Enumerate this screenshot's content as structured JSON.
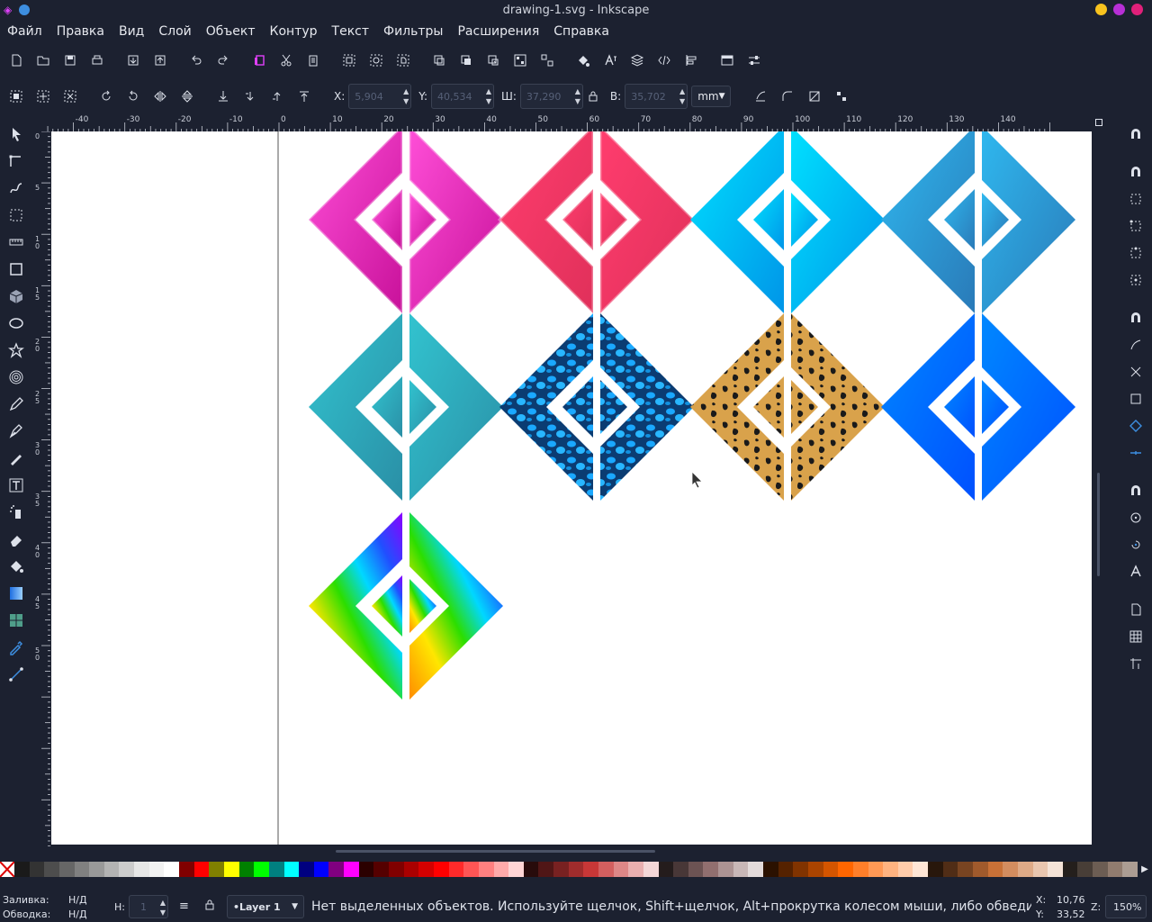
{
  "window": {
    "title": "drawing-1.svg - Inkscape"
  },
  "menu": [
    "Файл",
    "Правка",
    "Вид",
    "Слой",
    "Объект",
    "Контур",
    "Текст",
    "Фильтры",
    "Расширения",
    "Справка"
  ],
  "toolbar1": [
    "new-document-icon",
    "open-icon",
    "save-icon",
    "print-icon",
    "import-icon",
    "export-icon",
    "undo-icon",
    "redo-icon",
    "copy-icon",
    "cut-icon",
    "paste-icon",
    "zoom-selection-icon",
    "zoom-drawing-icon",
    "zoom-page-icon",
    "duplicate-icon",
    "clone-icon",
    "unlink-clone-icon",
    "group-icon",
    "ungroup-icon",
    "fill-stroke-icon",
    "text-font-icon",
    "layers-icon",
    "xml-editor-icon",
    "align-icon",
    "document-properties-icon",
    "preferences-icon"
  ],
  "toolbar2": {
    "x_label": "X:",
    "x_value": "5,904",
    "y_label": "Y:",
    "y_value": "40,534",
    "w_label": "Ш:",
    "w_value": "37,290",
    "h_label": "В:",
    "h_value": "35,702",
    "unit": "mm"
  },
  "ruler_h_labels": [
    "-40",
    "-30",
    "-20",
    "-10",
    "0",
    "10",
    "20",
    "30",
    "40",
    "50",
    "60",
    "70",
    "80",
    "90",
    "100",
    "110",
    "120",
    "130",
    "140"
  ],
  "ruler_v_labels": [
    "0",
    "5",
    "10",
    "15",
    "20",
    "25",
    "30",
    "35",
    "40",
    "45",
    "50"
  ],
  "colors": {
    "bg": "#1c2130",
    "canvas": "#ffffff",
    "accent": "#e040fb"
  },
  "palette": [
    "#1a1a1a",
    "#333333",
    "#4d4d4d",
    "#666666",
    "#808080",
    "#999999",
    "#b3b3b3",
    "#cccccc",
    "#e6e6e6",
    "#f2f2f2",
    "#ffffff",
    "#800000",
    "#ff0000",
    "#808000",
    "#ffff00",
    "#008000",
    "#00ff00",
    "#008080",
    "#00ffff",
    "#000080",
    "#0000ff",
    "#800080",
    "#ff00ff",
    "#2b0000",
    "#550000",
    "#800000",
    "#aa0000",
    "#d40000",
    "#ff0000",
    "#ff2a2a",
    "#ff5555",
    "#ff8080",
    "#ffaaaa",
    "#ffd5d5",
    "#280b0b",
    "#501616",
    "#782121",
    "#a02c2c",
    "#c83737",
    "#d35f5f",
    "#de8787",
    "#e9afaf",
    "#f4d7d7",
    "#241c1c",
    "#483737",
    "#6c5353",
    "#916f6f",
    "#ac9393",
    "#c8b7b7",
    "#e3dbdb",
    "#2b1100",
    "#552200",
    "#803300",
    "#aa4400",
    "#d45500",
    "#ff6600",
    "#ff7f2a",
    "#ff9955",
    "#ffb380",
    "#ffccaa",
    "#ffe6d5",
    "#28170b",
    "#502d16",
    "#784421",
    "#a05a2c",
    "#c87137",
    "#d38d5f",
    "#deaa87",
    "#e9c6af",
    "#f4e3d7",
    "#241f1c",
    "#483e37",
    "#6c5d53",
    "#917c6f",
    "#ac9d93"
  ],
  "status": {
    "fill_label": "Заливка:",
    "fill_value": "Н/Д",
    "stroke_label": "Обводка:",
    "stroke_value": "Н/Д",
    "opacity_label": "Н:",
    "opacity_value": "1",
    "layer": "•Layer 1",
    "message": "Нет выделенных объектов. Используйте щелчок, Shift+щелчок, Alt+прокрутка колесом мыши, либо обведите объекты р...",
    "x_label": "X:",
    "x_value": "10,76",
    "y_label": "Y:",
    "y_value": "33,52",
    "zoom_label": "Z:",
    "zoom_value": "150%"
  },
  "diamonds": [
    {
      "name": "magenta-diamond",
      "c1": "#ff4fd8",
      "c2": "#c8119a"
    },
    {
      "name": "red-diamond",
      "c1": "#ff3d6e",
      "c2": "#e0305a"
    },
    {
      "name": "cyan-diamond",
      "c1": "#00e1ff",
      "c2": "#0095e8"
    },
    {
      "name": "steelblue-diamond",
      "c1": "#2fb8ef",
      "c2": "#2a7ab8"
    },
    {
      "name": "teal-diamond",
      "c1": "#32c3cf",
      "c2": "#2a8fa6"
    },
    {
      "name": "blue-texture-diamond",
      "c1": "#1aa8ff",
      "c2": "#0a3a6e"
    },
    {
      "name": "leopard-diamond",
      "c1": "#d8a04a",
      "c2": "#1a1a1a"
    },
    {
      "name": "blue-diamond",
      "c1": "#0088ff",
      "c2": "#0050ff"
    },
    {
      "name": "rainbow-diamond",
      "c1": "#ffcc00",
      "c2": "#7a00ff"
    }
  ]
}
